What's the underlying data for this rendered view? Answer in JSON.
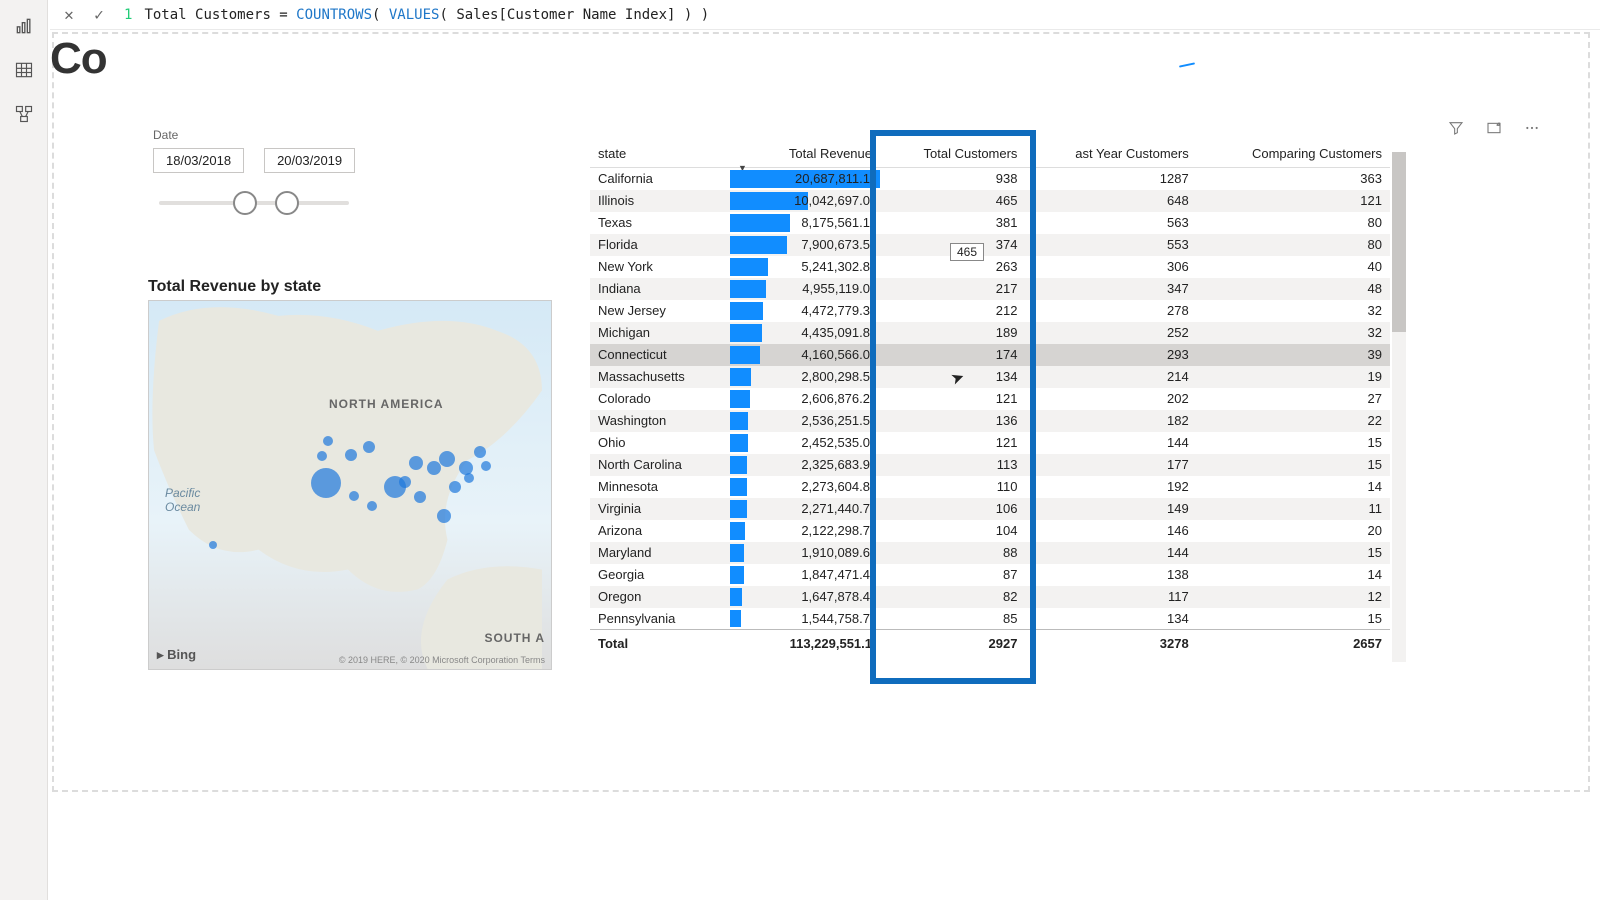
{
  "formula_bar": {
    "line_no": "1",
    "prefix": "Total Customers = ",
    "fn1": "COUNTROWS",
    "paren1": "( ",
    "fn2": "VALUES",
    "paren2": "( ",
    "arg": "Sales[Customer Name Index]",
    "close": " ) )",
    "cancel_glyph": "✕",
    "commit_glyph": "✓"
  },
  "nav": {
    "report": "report-view",
    "data": "data-view",
    "model": "model-view"
  },
  "title_stub": "Co",
  "actions": {
    "filter": "filter-icon",
    "focus": "focus-mode-icon",
    "more": "more-options-icon"
  },
  "date": {
    "label": "Date",
    "start": "18/03/2018",
    "end": "20/03/2019"
  },
  "map": {
    "title": "Total Revenue by state",
    "na_label": "NORTH AMERICA",
    "sa_label": "SOUTH A",
    "ocean": "Pacific\nOcean",
    "bing": "Bing",
    "credit": "© 2019 HERE, © 2020 Microsoft Corporation  Terms"
  },
  "table": {
    "headers": [
      "state",
      "Total Revenue",
      "Total Customers",
      "ast Year Customers",
      "Comparing Customers"
    ],
    "rows": [
      {
        "state": "California",
        "rev": "20,687,811.1",
        "revpct": 100,
        "tc": "938",
        "ly": "1287",
        "cc": "363"
      },
      {
        "state": "Illinois",
        "rev": "10,042,697.0",
        "revpct": 52,
        "tc": "465",
        "ly": "648",
        "cc": "121"
      },
      {
        "state": "Texas",
        "rev": "8,175,561.1",
        "revpct": 40,
        "tc": "381",
        "ly": "563",
        "cc": "80"
      },
      {
        "state": "Florida",
        "rev": "7,900,673.5",
        "revpct": 38,
        "tc": "374",
        "ly": "553",
        "cc": "80"
      },
      {
        "state": "New York",
        "rev": "5,241,302.8",
        "revpct": 25,
        "tc": "263",
        "ly": "306",
        "cc": "40"
      },
      {
        "state": "Indiana",
        "rev": "4,955,119.0",
        "revpct": 24,
        "tc": "217",
        "ly": "347",
        "cc": "48"
      },
      {
        "state": "New Jersey",
        "rev": "4,472,779.3",
        "revpct": 22,
        "tc": "212",
        "ly": "278",
        "cc": "32"
      },
      {
        "state": "Michigan",
        "rev": "4,435,091.8",
        "revpct": 21,
        "tc": "189",
        "ly": "252",
        "cc": "32"
      },
      {
        "state": "Connecticut",
        "rev": "4,160,566.0",
        "revpct": 20,
        "tc": "174",
        "ly": "293",
        "cc": "39",
        "hl": true
      },
      {
        "state": "Massachusetts",
        "rev": "2,800,298.5",
        "revpct": 14,
        "tc": "134",
        "ly": "214",
        "cc": "19"
      },
      {
        "state": "Colorado",
        "rev": "2,606,876.2",
        "revpct": 13,
        "tc": "121",
        "ly": "202",
        "cc": "27"
      },
      {
        "state": "Washington",
        "rev": "2,536,251.5",
        "revpct": 12,
        "tc": "136",
        "ly": "182",
        "cc": "22"
      },
      {
        "state": "Ohio",
        "rev": "2,452,535.0",
        "revpct": 12,
        "tc": "121",
        "ly": "144",
        "cc": "15"
      },
      {
        "state": "North Carolina",
        "rev": "2,325,683.9",
        "revpct": 11,
        "tc": "113",
        "ly": "177",
        "cc": "15"
      },
      {
        "state": "Minnesota",
        "rev": "2,273,604.8",
        "revpct": 11,
        "tc": "110",
        "ly": "192",
        "cc": "14"
      },
      {
        "state": "Virginia",
        "rev": "2,271,440.7",
        "revpct": 11,
        "tc": "106",
        "ly": "149",
        "cc": "11"
      },
      {
        "state": "Arizona",
        "rev": "2,122,298.7",
        "revpct": 10,
        "tc": "104",
        "ly": "146",
        "cc": "20"
      },
      {
        "state": "Maryland",
        "rev": "1,910,089.6",
        "revpct": 9,
        "tc": "88",
        "ly": "144",
        "cc": "15"
      },
      {
        "state": "Georgia",
        "rev": "1,847,471.4",
        "revpct": 9,
        "tc": "87",
        "ly": "138",
        "cc": "14"
      },
      {
        "state": "Oregon",
        "rev": "1,647,878.4",
        "revpct": 8,
        "tc": "82",
        "ly": "117",
        "cc": "12"
      },
      {
        "state": "Pennsylvania",
        "rev": "1,544,758.7",
        "revpct": 7,
        "tc": "85",
        "ly": "134",
        "cc": "15"
      }
    ],
    "total_label": "Total",
    "totals": {
      "rev": "113,229,551.1",
      "tc": "2927",
      "ly": "3278",
      "cc": "2657"
    }
  },
  "tooltip_value": "465",
  "chart_data": {
    "type": "table",
    "title": "Total Revenue / Customers by state",
    "columns": [
      "state",
      "Total Revenue",
      "Total Customers",
      "Last Year Customers",
      "Comparing Customers"
    ],
    "data": [
      [
        "California",
        20687811.1,
        938,
        1287,
        363
      ],
      [
        "Illinois",
        10042697.0,
        465,
        648,
        121
      ],
      [
        "Texas",
        8175561.1,
        381,
        563,
        80
      ],
      [
        "Florida",
        7900673.5,
        374,
        553,
        80
      ],
      [
        "New York",
        5241302.8,
        263,
        306,
        40
      ],
      [
        "Indiana",
        4955119.0,
        217,
        347,
        48
      ],
      [
        "New Jersey",
        4472779.3,
        212,
        278,
        32
      ],
      [
        "Michigan",
        4435091.8,
        189,
        252,
        32
      ],
      [
        "Connecticut",
        4160566.0,
        174,
        293,
        39
      ],
      [
        "Massachusetts",
        2800298.5,
        134,
        214,
        19
      ],
      [
        "Colorado",
        2606876.2,
        121,
        202,
        27
      ],
      [
        "Washington",
        2536251.5,
        136,
        182,
        22
      ],
      [
        "Ohio",
        2452535.0,
        121,
        144,
        15
      ],
      [
        "North Carolina",
        2325683.9,
        113,
        177,
        15
      ],
      [
        "Minnesota",
        2273604.8,
        110,
        192,
        14
      ],
      [
        "Virginia",
        2271440.7,
        106,
        149,
        11
      ],
      [
        "Arizona",
        2122298.7,
        104,
        146,
        20
      ],
      [
        "Maryland",
        1910089.6,
        88,
        144,
        15
      ],
      [
        "Georgia",
        1847471.4,
        87,
        138,
        14
      ],
      [
        "Oregon",
        1647878.4,
        82,
        117,
        12
      ],
      [
        "Pennsylvania",
        1544758.7,
        85,
        134,
        15
      ]
    ],
    "totals": [
      113229551.1,
      2927,
      3278,
      2657
    ]
  }
}
